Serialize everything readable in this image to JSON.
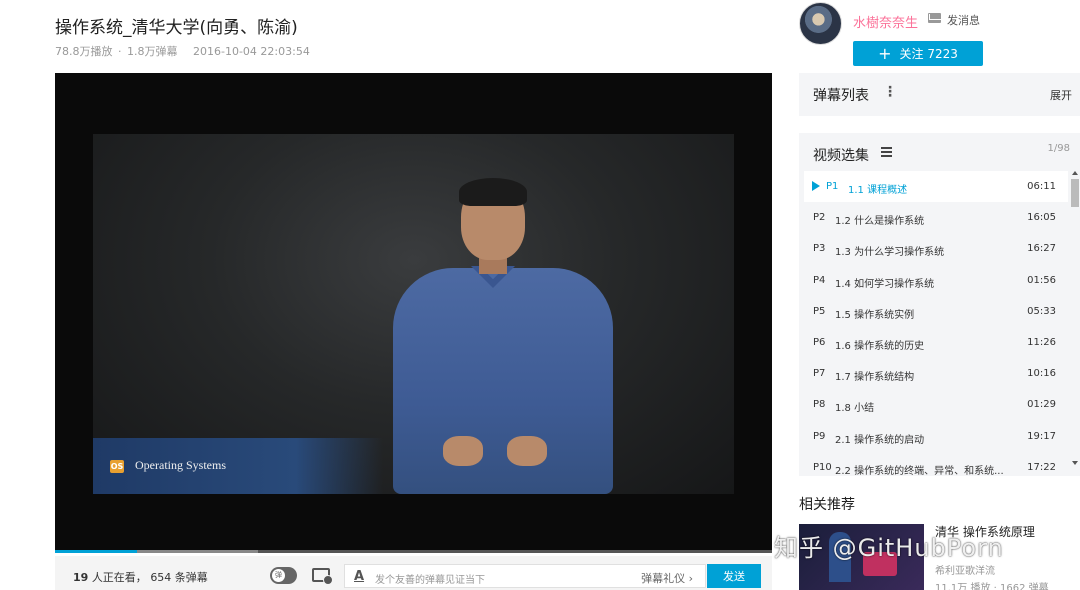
{
  "video": {
    "title": "操作系统_清华大学(向勇、陈渝)",
    "plays": "78.8万播放",
    "separator": "·",
    "danmaku_count": "1.8万弹幕",
    "date": "2016-10-04 22:03:54"
  },
  "uploader": {
    "name": "水樹奈奈生",
    "message_label": "发消息",
    "follow_label": "关注 7223",
    "follow_plus": "+"
  },
  "player": {
    "overlay_badge": "OS",
    "overlay_title": "Operating Systems",
    "progress_fraction": 0.115,
    "buffer_fraction": 0.283
  },
  "danmaku_bar": {
    "viewers_count": "19",
    "viewers_text": "人正在看，",
    "danmaku_text": "654 条弹幕",
    "toggle_label": "弹",
    "font_icon": "A",
    "placeholder": "发个友善的弹幕见证当下",
    "etiquette": "弹幕礼仪 ›",
    "send_label": "发送"
  },
  "danmaku_list": {
    "title": "弹幕列表",
    "more_icon": "⋮",
    "expand_label": "展开"
  },
  "episodes": {
    "title": "视频选集",
    "count": "1/98",
    "items": [
      {
        "p": "P1",
        "name": "1.1 课程概述",
        "duration": "06:11",
        "active": true
      },
      {
        "p": "P2",
        "name": "1.2 什么是操作系统",
        "duration": "16:05"
      },
      {
        "p": "P3",
        "name": "1.3 为什么学习操作系统",
        "duration": "16:27"
      },
      {
        "p": "P4",
        "name": "1.4 如何学习操作系统",
        "duration": "01:56"
      },
      {
        "p": "P5",
        "name": "1.5 操作系统实例",
        "duration": "05:33"
      },
      {
        "p": "P6",
        "name": "1.6 操作系统的历史",
        "duration": "11:26"
      },
      {
        "p": "P7",
        "name": "1.7 操作系统结构",
        "duration": "10:16"
      },
      {
        "p": "P8",
        "name": "1.8 小结",
        "duration": "01:29"
      },
      {
        "p": "P9",
        "name": "2.1 操作系统的启动",
        "duration": "19:17"
      },
      {
        "p": "P10",
        "name": "2.2 操作系统的终端、异常、和系统...",
        "duration": "17:22"
      }
    ]
  },
  "recommend": {
    "title": "相关推荐",
    "item_title": "清华 操作系统原理",
    "item_author": "希利亚歌洋流",
    "item_stats": "11.1万 播放 · 1662 弹幕"
  },
  "watermark": "知乎 @GitHubPorn",
  "colors": {
    "accent": "#00a1d6",
    "uploader_name": "#fb7299"
  }
}
